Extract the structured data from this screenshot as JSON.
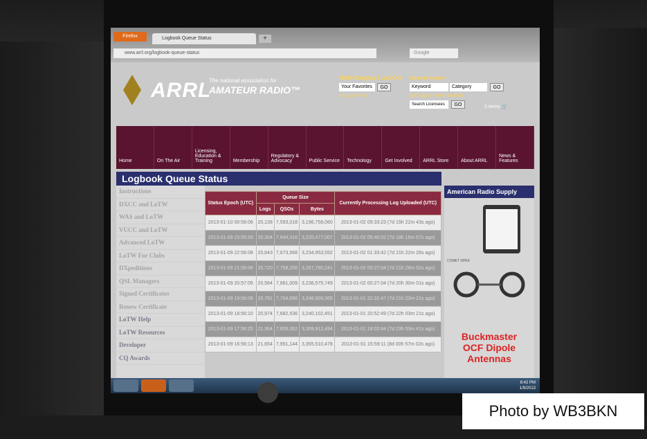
{
  "browser": {
    "app_button": "Firefox",
    "tab_title": "Logbook Queue Status",
    "new_tab": "+",
    "url": "www.arrl.org/logbook-queue-status",
    "search_placeholder": "Google"
  },
  "header": {
    "logo_text": "ARRL",
    "tagline_top": "The national association for",
    "tagline_bottom": "AMATEUR RADIO™",
    "hello": "Hello Douglas",
    "log_out": "Log Out",
    "favorites": "Your Favorites",
    "go": "GO",
    "edit_profile": "Edit your Profile",
    "website_search": "Website Search",
    "keyword": "Keyword",
    "category": "Category",
    "call_sign_search": "Call Sign / Name Search",
    "search_licensees": "Search Licensees",
    "cart": "0 items"
  },
  "nav": [
    "Home",
    "On The Air",
    "Licensing, Education & Training",
    "Membership",
    "Regulatory & Advocacy",
    "Public Service",
    "Technology",
    "Get Involved",
    "ARRL Store",
    "About ARRL",
    "News & Features"
  ],
  "page_title": "Logbook Queue Status",
  "sidebar": [
    {
      "label": "Instructions",
      "dark": false
    },
    {
      "label": "DXCC and LoTW",
      "dark": false
    },
    {
      "label": "WAS and LoTW",
      "dark": false
    },
    {
      "label": "VUCC and LoTW",
      "dark": false
    },
    {
      "label": "Advanced LoTW",
      "dark": false
    },
    {
      "label": "LoTW For Clubs",
      "dark": false
    },
    {
      "label": "DXpeditions",
      "dark": false
    },
    {
      "label": "QSL Managers",
      "dark": false
    },
    {
      "label": "Signed Certificates",
      "dark": false
    },
    {
      "label": "Renew Certificate",
      "dark": false
    },
    {
      "label": "LoTW Help",
      "dark": true
    },
    {
      "label": "LoTW Resources",
      "dark": true
    },
    {
      "label": "Developer",
      "dark": true
    },
    {
      "label": "CQ Awards",
      "dark": true
    }
  ],
  "table": {
    "headers": {
      "status_epoch": "Status Epoch (UTC)",
      "queue_size": "Queue Size",
      "logs": "Logs",
      "qsos": "QSOs",
      "bytes": "Bytes",
      "processing": "Currently Processing Log Uploaded (UTC)"
    },
    "rows": [
      {
        "epoch": "2013-01-10 00:56:06",
        "logs": "20,138",
        "qsos": "7,593,018",
        "bytes": "3,196,758,060",
        "processing": "2013-01-02 09:33:23 (7d 15h 22m 43s ago)",
        "alt": false
      },
      {
        "epoch": "2013-01-09 23:55:59",
        "logs": "20,304",
        "qsos": "7,644,316",
        "bytes": "3,220,477,007",
        "processing": "2013-01-02 05:40:02 (7d 18h 15m 57s ago)",
        "alt": true
      },
      {
        "epoch": "2013-01-09 22:56:08",
        "logs": "20,643",
        "qsos": "7,673,568",
        "bytes": "3,234,953,552",
        "processing": "2013-01-02 01:33:42 (7d 21h 22m 26s ago)",
        "alt": false
      },
      {
        "epoch": "2013-01-09 21:56:06",
        "logs": "20,720",
        "qsos": "7,758,256",
        "bytes": "3,267,780,241",
        "processing": "2013-01-02 00:27:04 (7d 21h 29m 02s ago)",
        "alt": true
      },
      {
        "epoch": "2013-01-09 20:57:05",
        "logs": "20,584",
        "qsos": "7,681,009",
        "bytes": "3,236,575,749",
        "processing": "2013-01-02 00:27:04 (7d 20h 30m 01s ago)",
        "alt": false
      },
      {
        "epoch": "2013-01-09 19:56:08",
        "logs": "20,791",
        "qsos": "7,704,666",
        "bytes": "3,248,509,365",
        "processing": "2013-01-01 22:32:47 (7d 21h 23m 21s ago)",
        "alt": true
      },
      {
        "epoch": "2013-01-09 18:56:10",
        "logs": "20,974",
        "qsos": "7,682,536",
        "bytes": "3,240,102,451",
        "processing": "2013-01-01 20:52:49 (7d 22h 03m 21s ago)",
        "alt": false
      },
      {
        "epoch": "2013-01-09 17:56:25",
        "logs": "21,364",
        "qsos": "7,835,062",
        "bytes": "3,309,912,494",
        "processing": "2013-01-01 18:02:44 (7d 23h 53m 41s ago)",
        "alt": true
      },
      {
        "epoch": "2013-01-09 16:56:13",
        "logs": "21,654",
        "qsos": "7,951,144",
        "bytes": "3,355,510,478",
        "processing": "2013-01-01 15:59:11 (8d 00h 57m 02s ago)",
        "alt": false
      }
    ]
  },
  "ad": {
    "title": "American Radio Supply",
    "brands": "COMET  DPEK",
    "line1": "Buckmaster",
    "line2": "OCF Dipole",
    "line3": "Antennas"
  },
  "taskbar": {
    "time": "8:42 PM",
    "date": "1/9/2013"
  },
  "caption": "Photo by WB3BKN"
}
